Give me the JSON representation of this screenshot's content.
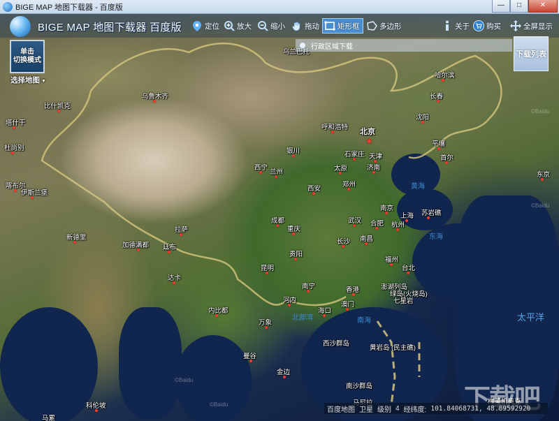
{
  "window": {
    "title": "BIGE MAP 地图下载器 - 百度版",
    "buttons": {
      "minimize": "—",
      "maximize": "□",
      "close": "✕"
    }
  },
  "toolbar": {
    "brand": "BIGE MAP 地图下载器 百度版",
    "tools": [
      {
        "label": "定位",
        "icon": "location-pin-icon"
      },
      {
        "label": "放大",
        "icon": "zoom-in-icon"
      },
      {
        "label": "缩小",
        "icon": "zoom-out-icon"
      },
      {
        "label": "拖动",
        "icon": "hand-drag-icon"
      },
      {
        "label": "矩形框",
        "icon": "rectangle-select-icon",
        "active": true
      },
      {
        "label": "多边形",
        "icon": "polygon-select-icon"
      },
      {
        "label": "关于",
        "icon": "info-icon"
      },
      {
        "label": "购买",
        "icon": "cart-icon"
      },
      {
        "label": "全屏显示",
        "icon": "fullscreen-icon"
      }
    ]
  },
  "side": {
    "switch_mode": "单击\n切换模式",
    "select_map": "选择地图"
  },
  "region_bar": {
    "label": "行政区域下载"
  },
  "download_list": {
    "label": "下载列表"
  },
  "status": {
    "map_name": "百度地图",
    "layer": "卫星",
    "level_label": "级别",
    "level_value": "4",
    "coord_label": "经纬度:",
    "coord_value": "101.84068731, 48.89592920"
  },
  "map": {
    "cities": [
      {
        "name": "乌兰巴托"
      },
      {
        "name": "哈尔滨"
      },
      {
        "name": "乌鲁木齐"
      },
      {
        "name": "长春"
      },
      {
        "name": "比什凯克"
      },
      {
        "name": "沈阳"
      },
      {
        "name": "塔什干"
      },
      {
        "name": "呼和浩特"
      },
      {
        "name": "北京"
      },
      {
        "name": "平壤"
      },
      {
        "name": "杜尚别"
      },
      {
        "name": "银川"
      },
      {
        "name": "石家庄"
      },
      {
        "name": "天津"
      },
      {
        "name": "首尔"
      },
      {
        "name": "西宁"
      },
      {
        "name": "兰州"
      },
      {
        "name": "太原"
      },
      {
        "name": "济南"
      },
      {
        "name": "东京"
      },
      {
        "name": "喀布尔"
      },
      {
        "name": "西安"
      },
      {
        "name": "郑州"
      },
      {
        "name": "伊斯兰堡"
      },
      {
        "name": "南京"
      },
      {
        "name": "苏岩礁"
      },
      {
        "name": "上海"
      },
      {
        "name": "成都"
      },
      {
        "name": "武汉"
      },
      {
        "name": "合肥"
      },
      {
        "name": "杭州"
      },
      {
        "name": "新德里"
      },
      {
        "name": "拉萨"
      },
      {
        "name": "重庆"
      },
      {
        "name": "加德满都"
      },
      {
        "name": "廷布"
      },
      {
        "name": "长沙"
      },
      {
        "name": "南昌"
      },
      {
        "name": "贵阳"
      },
      {
        "name": "福州"
      },
      {
        "name": "昆明"
      },
      {
        "name": "台北"
      },
      {
        "name": "达卡"
      },
      {
        "name": "南宁"
      },
      {
        "name": "香港"
      },
      {
        "name": "澎湖列岛"
      },
      {
        "name": "绿岛(火烧岛)"
      },
      {
        "name": "七星岩"
      },
      {
        "name": "内比都"
      },
      {
        "name": "河内"
      },
      {
        "name": "海口"
      },
      {
        "name": "澳门"
      },
      {
        "name": "万象"
      },
      {
        "name": "西沙群岛"
      },
      {
        "name": "黄岩岛\n(民主礁)"
      },
      {
        "name": "曼谷"
      },
      {
        "name": "金边"
      },
      {
        "name": "南沙群岛"
      },
      {
        "name": "马尼拉"
      },
      {
        "name": "科伦坡"
      },
      {
        "name": "梅莱凯奥克"
      },
      {
        "name": "马累"
      }
    ],
    "seas": [
      {
        "name": "黄海"
      },
      {
        "name": "东海"
      },
      {
        "name": "北部湾"
      },
      {
        "name": "南海"
      },
      {
        "name": "太平洋"
      }
    ]
  },
  "watermark": {
    "text": "下载吧"
  },
  "colors": {
    "accent": "#4696e6",
    "city_dot": "#ff3b2f",
    "border_line": "#d7c77e"
  }
}
